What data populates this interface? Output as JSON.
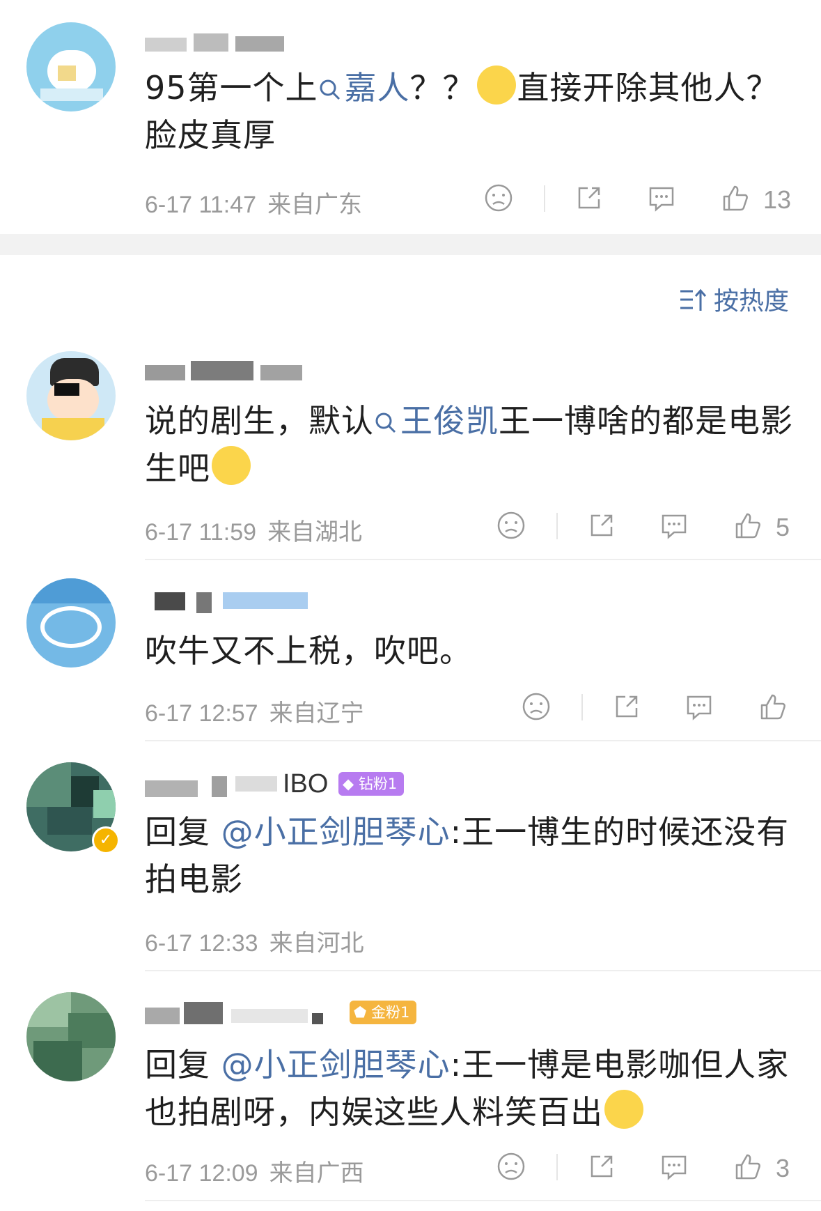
{
  "sort": {
    "label": "按热度"
  },
  "comments": [
    {
      "text_parts": [
        "95第一个上",
        "嘉人",
        "？？",
        "直接开除其他人？脸皮真厚"
      ],
      "time": "6-17 11:47",
      "location": "来自广东",
      "likes": "13"
    },
    {
      "text_parts": [
        "说的剧生，默认",
        "王俊凯",
        "王一博啥的都是电影生吧"
      ],
      "time": "6-17 11:59",
      "location": "来自湖北",
      "likes": "5"
    },
    {
      "text_parts": [
        "吹牛又不上税，吹吧。"
      ],
      "time": "6-17 12:57",
      "location": "来自辽宁",
      "likes": ""
    },
    {
      "username_suffix": "IBO",
      "badge": "钻粉1",
      "text_parts": [
        "回复 ",
        "@小正剑胆琴心",
        ":王一博生的时候还没有拍电影"
      ],
      "time": "6-17 12:33",
      "location": "来自河北"
    },
    {
      "badge": "金粉1",
      "text_parts": [
        "回复 ",
        "@小正剑胆琴心",
        ":王一博是电影咖但人家也拍剧呀，内娱这些人料笑百出"
      ],
      "time": "6-17 12:09",
      "location": "来自广西",
      "likes": "3"
    }
  ],
  "colors": {
    "link": "#4a6fa5",
    "meta": "#9a9a9a",
    "diamond_badge": "#b77bf0",
    "gold_badge": "#f5b53f",
    "section_bg": "#f2f2f2"
  }
}
